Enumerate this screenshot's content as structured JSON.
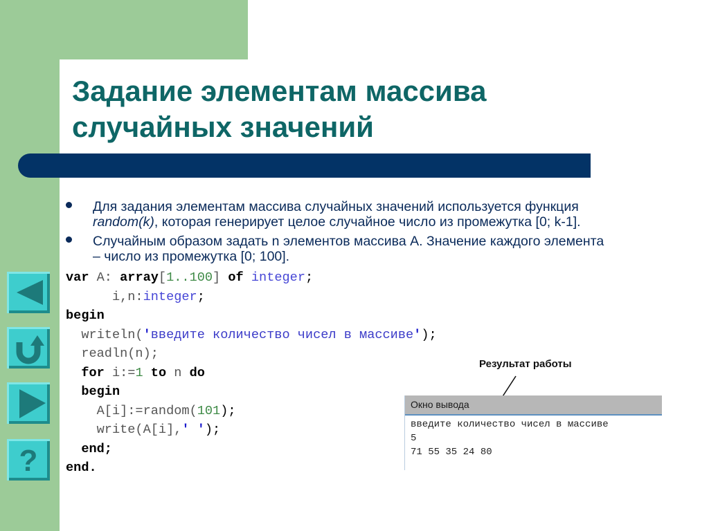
{
  "slide": {
    "title_lines": [
      "Задание элементам массива",
      "случайных значений"
    ],
    "bullets": [
      {
        "line1": "Для задания элементам массива случайных значений используется функция",
        "line2_italic": "random(k)",
        "line2_rest": ", которая генерирует целое случайное число из промежутка [0; k-1]."
      },
      {
        "line1": "Случайным образом задать n элементов массива А. Значение каждого элемента",
        "line2": "– число из промежутка [0; 100]."
      }
    ],
    "code": {
      "l1": {
        "kw1": "var",
        "id1": " A: ",
        "kw2": "array",
        "p1": "[",
        "n1": "1..100",
        "p2": "] ",
        "kw3": "of",
        "sp": " ",
        "typ": "integer",
        "end": ";"
      },
      "l2": {
        "indent": "      ",
        "ids": "i,n:",
        "typ": "integer",
        "end": ";"
      },
      "l3": {
        "kw": "begin"
      },
      "l4": {
        "indent": "  ",
        "fn": "writeln(",
        "q1": "'",
        "str": "введите количество чисел в массиве",
        "q2": "'",
        "end": ");"
      },
      "l5": {
        "indent": "  ",
        "text": "readln(n);"
      },
      "l6": {
        "indent": "  ",
        "kw1": "for",
        "id1": " i:=",
        "n1": "1",
        "sp": " ",
        "kw2": "to",
        "id2": " n ",
        "kw3": "do"
      },
      "l7": {
        "indent": "  ",
        "kw": "begin"
      },
      "l8": {
        "indent": "    ",
        "fn": "A[i]:=random(",
        "n1": "101",
        "end": ");"
      },
      "l9": {
        "indent": "    ",
        "fn": "write(A[i],",
        "q": "' '",
        "end": ");"
      },
      "l10": {
        "indent": "  ",
        "kw": "end;"
      },
      "l11": {
        "kw": "end."
      }
    },
    "result_label": "Результат работы",
    "output_window": {
      "title": "Окно вывода",
      "lines": [
        "введите количество чисел в массиве",
        "5",
        "71 55 35 24 80"
      ]
    },
    "nav_buttons": [
      {
        "name": "previous",
        "icon": "triangle-left-icon"
      },
      {
        "name": "return",
        "icon": "u-turn-arrow-icon"
      },
      {
        "name": "next",
        "icon": "triangle-right-icon"
      },
      {
        "name": "help",
        "icon": "question-mark-icon",
        "label": "?"
      }
    ],
    "colors": {
      "green": "#9ccb98",
      "title": "#0e6666",
      "bar": "#033366",
      "body_text": "#0a2a5a",
      "button": "#3ecdcd",
      "button_icon": "#1d7a7a"
    }
  }
}
